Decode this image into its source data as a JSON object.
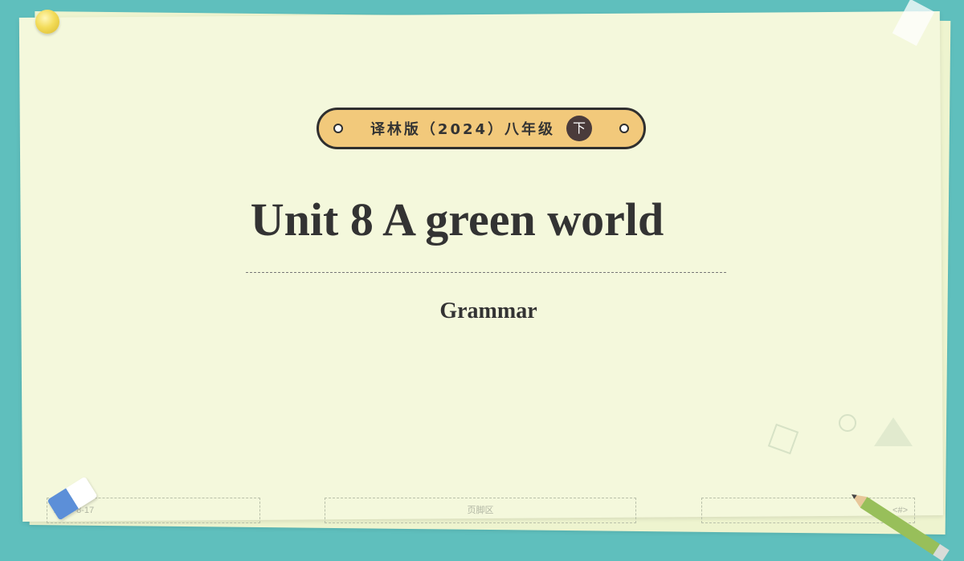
{
  "badge": {
    "text": "译林版（2024）八年级",
    "term": "下"
  },
  "title": "Unit 8 A green world",
  "subtitle": "Grammar",
  "footer": {
    "date": "2025-8-17",
    "center": "页脚区",
    "page_number": "<#>"
  },
  "colors": {
    "background": "#5fbfbd",
    "paper": "#f4f8dc",
    "badge_fill": "#f2c97b",
    "text": "#333333"
  }
}
